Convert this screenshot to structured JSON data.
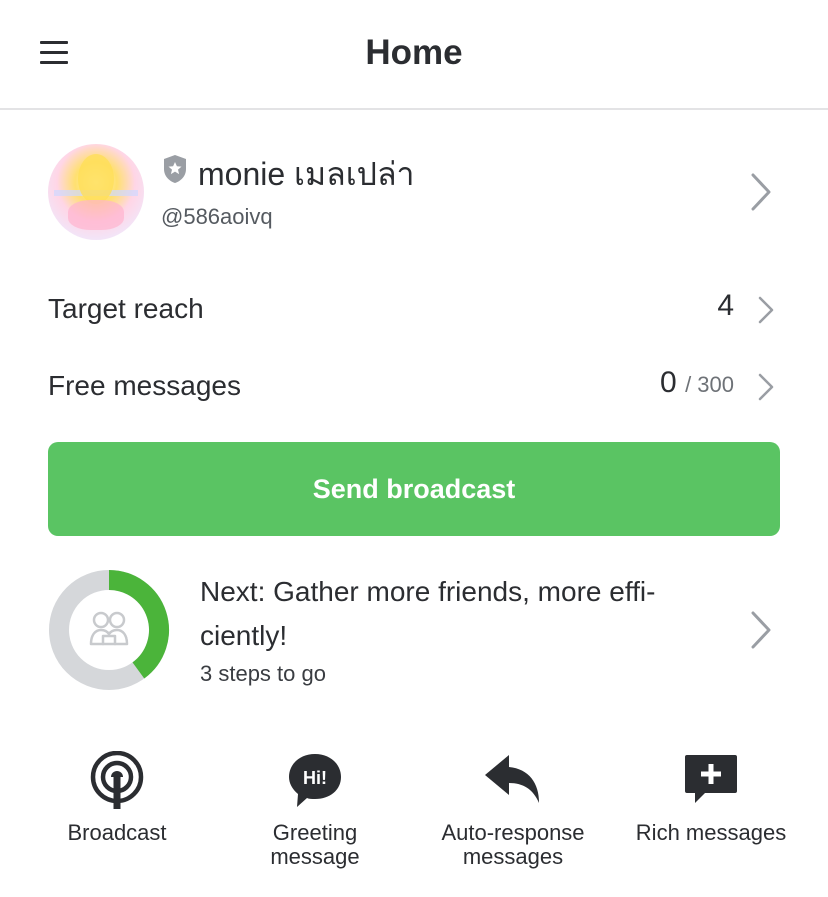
{
  "header": {
    "title": "Home",
    "menu_icon": "hamburger-menu-icon"
  },
  "profile": {
    "name": "monie เมลเปล่า",
    "account_id": "@586aoivq",
    "badge_icon": "shield-star-icon",
    "chevron_icon": "chevron-right-icon"
  },
  "stats": {
    "target_reach": {
      "label": "Target reach",
      "value": "4"
    },
    "free_messages": {
      "label": "Free messages",
      "value": "0",
      "limit": "/ 300"
    }
  },
  "send_broadcast": {
    "label": "Send broadcast"
  },
  "next_step": {
    "title": "Next: Gather more friends, more effi-\nciently!",
    "steps_left": "3 steps to go",
    "progress": 0.4,
    "icon": "friends-group-icon"
  },
  "shortcuts": [
    {
      "label": "Broadcast",
      "icon": "broadcast-icon"
    },
    {
      "label": "Greeting message",
      "icon": "greeting-hi-icon"
    },
    {
      "label": "Auto-response messages",
      "icon": "reply-arrow-icon"
    },
    {
      "label": "Rich messages",
      "icon": "add-message-icon"
    }
  ],
  "colors": {
    "accent_green": "#5ac463",
    "progress_green": "#4bb43a",
    "ring_gray": "#d5d7da",
    "text_dark": "#2b2d31"
  }
}
